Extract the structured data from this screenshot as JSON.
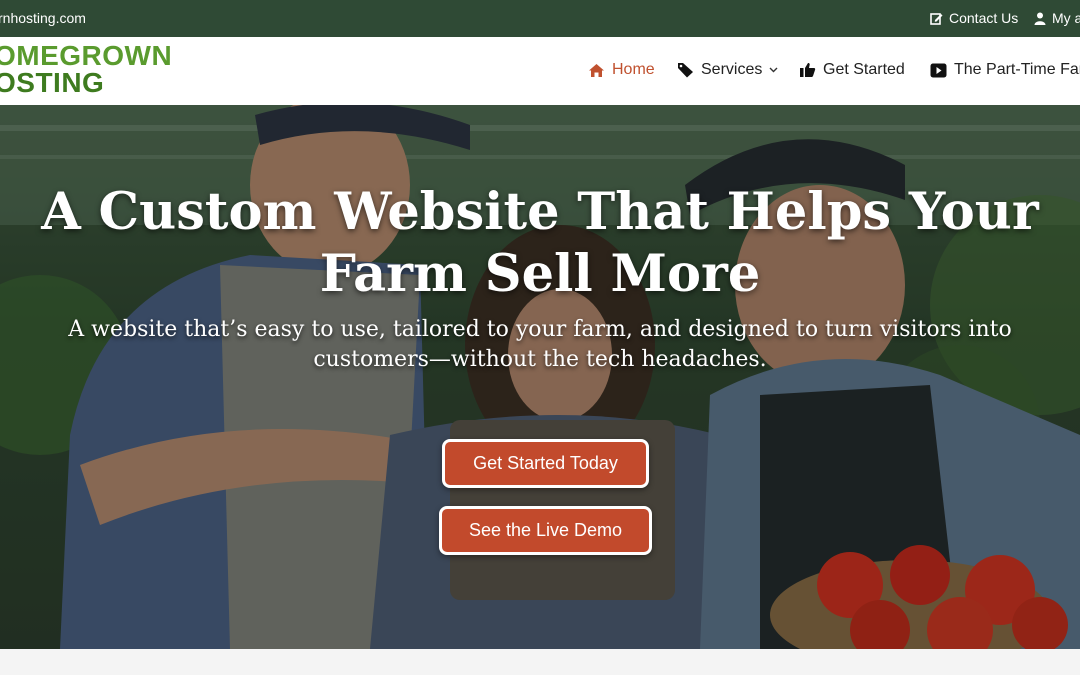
{
  "topbar": {
    "domain": "rnhosting.com",
    "contact_label": "Contact Us",
    "account_label": "My a"
  },
  "logo": {
    "line1": "OMEGROWN",
    "line2": "OSTING"
  },
  "nav": {
    "items": [
      {
        "label": "Home",
        "icon": "home-icon",
        "active": true
      },
      {
        "label": "Services",
        "icon": "tag-icon",
        "has_dropdown": true
      },
      {
        "label": "Get Started",
        "icon": "thumbs-up-icon"
      },
      {
        "label": "The Part-Time Far",
        "icon": "play-icon"
      }
    ]
  },
  "hero": {
    "title_line1": "A Custom Website That Helps Your",
    "title_line2": "Farm Sell More",
    "subtitle_line1": "A website that’s easy to use, tailored to your farm, and designed to turn visitors into",
    "subtitle_line2": "customers—without the tech headaches.",
    "cta_primary": "Get Started Today",
    "cta_secondary": "See the Live Demo"
  },
  "colors": {
    "topbar_bg": "#2f4a35",
    "accent": "#c24a2c",
    "logo_green": "#5a9b2e",
    "active_nav": "#c0512f"
  }
}
